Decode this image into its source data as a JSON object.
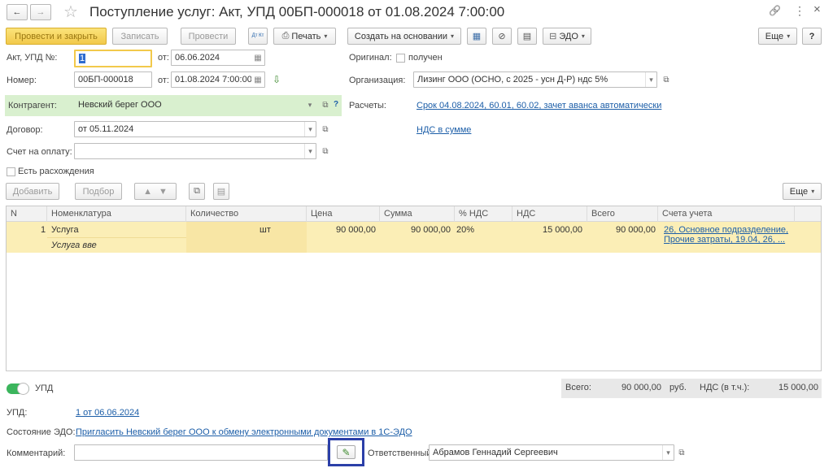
{
  "window": {
    "title": "Поступление услуг: Акт, УПД 00БП-000018 от 01.08.2024 7:00:00",
    "nav_back": "←",
    "nav_forward": "→",
    "star": "☆",
    "link_icon": "🔗",
    "more_icon": "⋮",
    "close_icon": "×"
  },
  "toolbar": {
    "post_close": "Провести и закрыть",
    "save": "Записать",
    "post": "Провести",
    "dtkt": "Дт Кт",
    "print": "Печать",
    "create_based": "Создать на основании",
    "edo": "ЭДО",
    "more": "Еще",
    "help": "?"
  },
  "form": {
    "act_label": "Акт, УПД №:",
    "act_value": "1",
    "act_from_label": "от:",
    "act_date": "06.06.2024",
    "number_label": "Номер:",
    "number_value": "00БП-000018",
    "number_from_label": "от:",
    "number_date": "01.08.2024  7:00:00",
    "original_label": "Оригинал:",
    "original_checkbox": "получен",
    "org_label": "Организация:",
    "org_value": "Лизинг ООО (ОСНО, с 2025 - усн Д-Р) ндс 5%",
    "counterparty_label": "Контрагент:",
    "counterparty_value": "Невский берег ООО",
    "settlements_label": "Расчеты:",
    "settlements_link": "Срок 04.08.2024, 60.01, 60.02, зачет аванса автоматически",
    "vat_link": "НДС в сумме",
    "contract_label": "Договор:",
    "contract_value": "от 05.11.2024",
    "invoice_label": "Счет на оплату:",
    "invoice_value": "",
    "discrepancy_label": "Есть расхождения"
  },
  "table_toolbar": {
    "add": "Добавить",
    "pick": "Подбор",
    "more": "Еще"
  },
  "table": {
    "columns": [
      "N",
      "Номенклатура",
      "Количество",
      "Цена",
      "Сумма",
      "% НДС",
      "НДС",
      "Всего",
      "Счета учета"
    ],
    "rows": [
      {
        "n": "1",
        "item": "Услуга",
        "item_sub": "Услуга вве",
        "unit": "шт",
        "price": "90 000,00",
        "sum": "90 000,00",
        "vat_rate": "20%",
        "vat": "15 000,00",
        "total": "90 000,00",
        "accounts_line1": "26, Основное подразделение,",
        "accounts_line2": "Прочие затраты, 19.04, 26, ..."
      }
    ]
  },
  "footer": {
    "upd_toggle_label": "УПД",
    "total_label": "Всего:",
    "total_value": "90 000,00",
    "currency": "руб.",
    "vat_label": "НДС (в т.ч.):",
    "vat_value": "15 000,00",
    "upd_label": "УПД:",
    "upd_link": "1 от 06.06.2024",
    "edo_state_label": "Состояние ЭДО:",
    "edo_state_link": "Пригласить Невский берег ООО к обмену электронными документами в 1С-ЭДО",
    "comment_label": "Комментарий:",
    "comment_value": "",
    "responsible_label": "Ответственный:",
    "responsible_value": "Абрамов Геннадий Сергеевич"
  },
  "colors": {
    "primary_button": "#f2c94b",
    "counterparty_row": "#d9f0cf",
    "selected_row": "#fbeeb6",
    "link": "#1c5ea8",
    "highlight_border": "#2b3fa8",
    "toggle_on": "#3bb55c"
  }
}
